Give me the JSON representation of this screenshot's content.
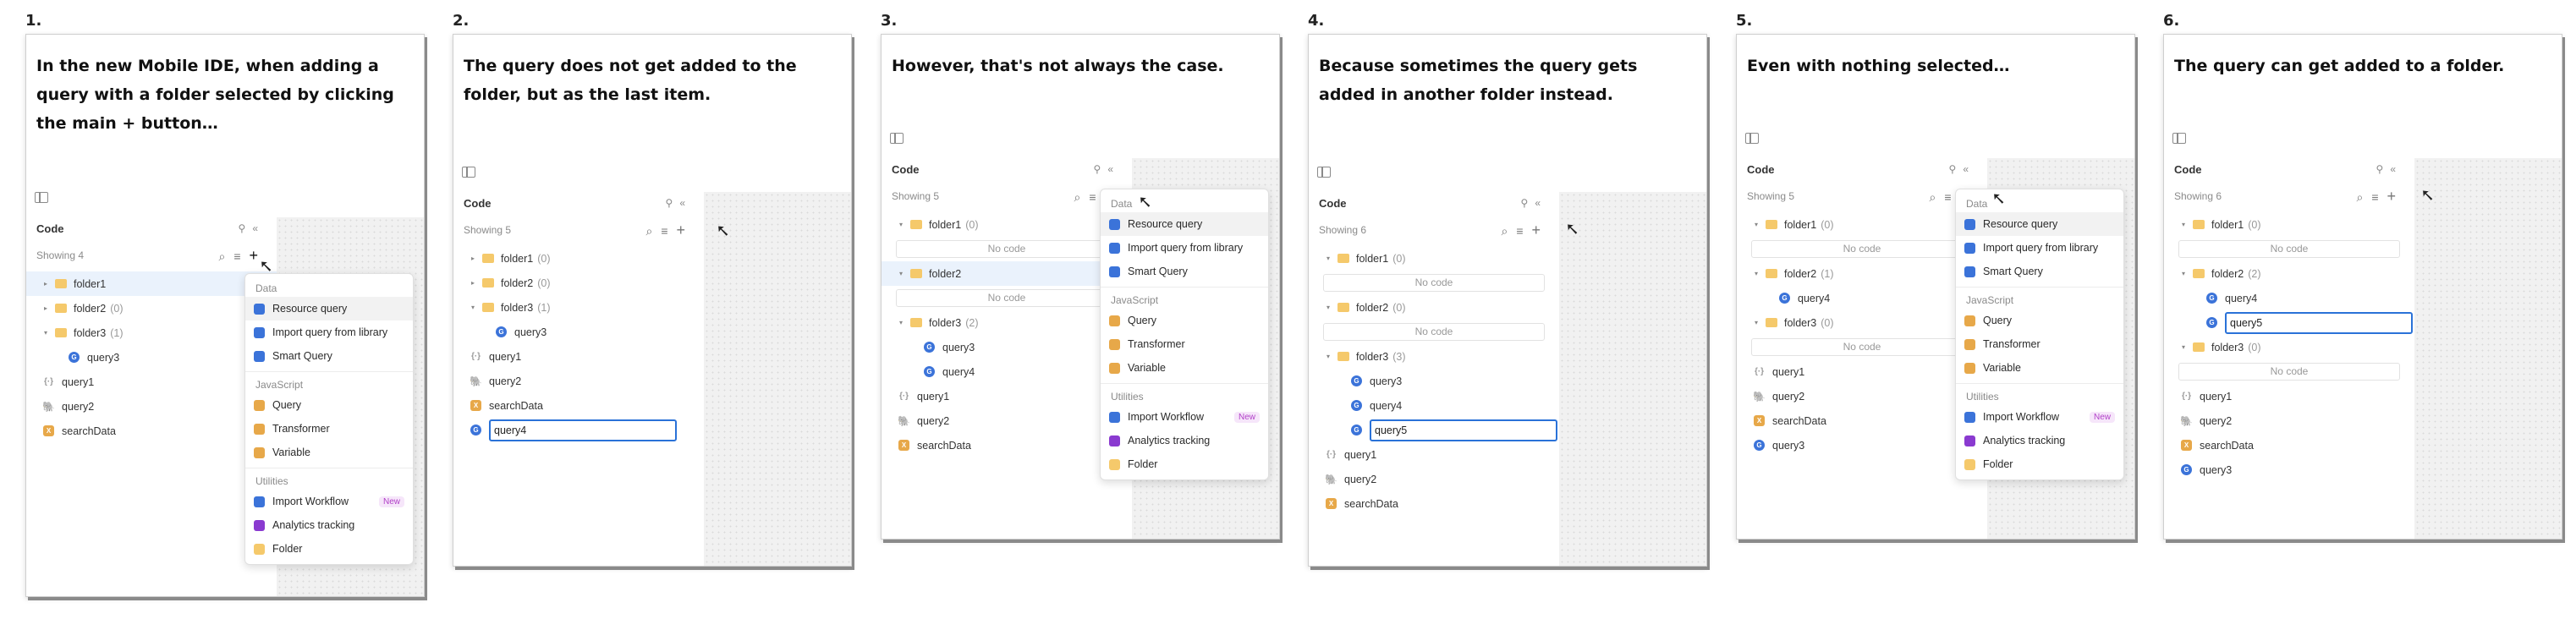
{
  "steps": [
    {
      "number": "1.",
      "caption": "In the new Mobile IDE, when adding a query with a folder selected by clicking the main + button…",
      "showing": "Showing 4",
      "tree": [
        {
          "kind": "folder",
          "label": "folder1",
          "caret": "▸",
          "selected": true
        },
        {
          "kind": "folder",
          "label": "folder2",
          "count": "(0)",
          "caret": "▸"
        },
        {
          "kind": "folder",
          "label": "folder3",
          "count": "(1)",
          "caret": "▾"
        },
        {
          "kind": "query",
          "label": "query3",
          "indent": true
        },
        {
          "kind": "transformer",
          "label": "query1"
        },
        {
          "kind": "pg",
          "label": "query2"
        },
        {
          "kind": "var",
          "label": "searchData"
        }
      ],
      "menu": true
    },
    {
      "number": "2.",
      "caption": "The query does not get added to the folder, but as the last item.",
      "showing": "Showing 5",
      "tree": [
        {
          "kind": "folder",
          "label": "folder1",
          "count": "(0)",
          "caret": "▸"
        },
        {
          "kind": "folder",
          "label": "folder2",
          "count": "(0)",
          "caret": "▸"
        },
        {
          "kind": "folder",
          "label": "folder3",
          "count": "(1)",
          "caret": "▾"
        },
        {
          "kind": "query",
          "label": "query3",
          "indent": true
        },
        {
          "kind": "transformer",
          "label": "query1"
        },
        {
          "kind": "pg",
          "label": "query2"
        },
        {
          "kind": "var",
          "label": "searchData"
        },
        {
          "kind": "query",
          "label": "query4",
          "editing": true
        }
      ]
    },
    {
      "number": "3.",
      "caption": "However, that's not always the case.",
      "showing": "Showing 5",
      "tree": [
        {
          "kind": "folder",
          "label": "folder1",
          "count": "(0)",
          "caret": "▾"
        },
        {
          "kind": "nocode"
        },
        {
          "kind": "folder",
          "label": "folder2",
          "caret": "▾",
          "selected": true
        },
        {
          "kind": "nocode"
        },
        {
          "kind": "folder",
          "label": "folder3",
          "count": "(2)",
          "caret": "▾"
        },
        {
          "kind": "query",
          "label": "query3",
          "indent": true
        },
        {
          "kind": "query",
          "label": "query4",
          "indent": true
        },
        {
          "kind": "transformer",
          "label": "query1"
        },
        {
          "kind": "pg",
          "label": "query2"
        },
        {
          "kind": "var",
          "label": "searchData"
        }
      ],
      "menu": true
    },
    {
      "number": "4.",
      "caption": "Because sometimes the query gets added in another folder instead.",
      "showing": "Showing 6",
      "tree": [
        {
          "kind": "folder",
          "label": "folder1",
          "count": "(0)",
          "caret": "▾"
        },
        {
          "kind": "nocode"
        },
        {
          "kind": "folder",
          "label": "folder2",
          "count": "(0)",
          "caret": "▾"
        },
        {
          "kind": "nocode"
        },
        {
          "kind": "folder",
          "label": "folder3",
          "count": "(3)",
          "caret": "▾"
        },
        {
          "kind": "query",
          "label": "query3",
          "indent": true
        },
        {
          "kind": "query",
          "label": "query4",
          "indent": true
        },
        {
          "kind": "query",
          "label": "query5",
          "indent": true,
          "editing": true
        },
        {
          "kind": "transformer",
          "label": "query1"
        },
        {
          "kind": "pg",
          "label": "query2"
        },
        {
          "kind": "var",
          "label": "searchData"
        }
      ]
    },
    {
      "number": "5.",
      "caption": "Even with nothing selected…",
      "showing": "Showing 5",
      "tree": [
        {
          "kind": "folder",
          "label": "folder1",
          "count": "(0)",
          "caret": "▾"
        },
        {
          "kind": "nocode"
        },
        {
          "kind": "folder",
          "label": "folder2",
          "count": "(1)",
          "caret": "▾"
        },
        {
          "kind": "query",
          "label": "query4",
          "indent": true
        },
        {
          "kind": "folder",
          "label": "folder3",
          "count": "(0)",
          "caret": "▾"
        },
        {
          "kind": "nocode"
        },
        {
          "kind": "transformer",
          "label": "query1"
        },
        {
          "kind": "pg",
          "label": "query2"
        },
        {
          "kind": "var",
          "label": "searchData"
        },
        {
          "kind": "query",
          "label": "query3"
        }
      ],
      "menu": true
    },
    {
      "number": "6.",
      "caption": "The query can get added to a folder.",
      "showing": "Showing 6",
      "tree": [
        {
          "kind": "folder",
          "label": "folder1",
          "count": "(0)",
          "caret": "▾"
        },
        {
          "kind": "nocode"
        },
        {
          "kind": "folder",
          "label": "folder2",
          "count": "(2)",
          "caret": "▾"
        },
        {
          "kind": "query",
          "label": "query4",
          "indent": true
        },
        {
          "kind": "query",
          "label": "query5",
          "indent": true,
          "editing": true
        },
        {
          "kind": "folder",
          "label": "folder3",
          "count": "(0)",
          "caret": "▾"
        },
        {
          "kind": "nocode"
        },
        {
          "kind": "transformer",
          "label": "query1"
        },
        {
          "kind": "pg",
          "label": "query2"
        },
        {
          "kind": "var",
          "label": "searchData"
        },
        {
          "kind": "query",
          "label": "query3"
        }
      ]
    }
  ],
  "panel": {
    "title": "Code",
    "no_code": "No code"
  },
  "menu": {
    "sections": [
      {
        "title": "Data",
        "items": [
          {
            "label": "Resource query",
            "color": "#3b73d9"
          },
          {
            "label": "Import query from library",
            "color": "#3b73d9"
          },
          {
            "label": "Smart Query",
            "color": "#3b73d9"
          }
        ]
      },
      {
        "title": "JavaScript",
        "items": [
          {
            "label": "Query",
            "color": "#e7a849"
          },
          {
            "label": "Transformer",
            "color": "#e7a849"
          },
          {
            "label": "Variable",
            "color": "#e7a849"
          }
        ]
      },
      {
        "title": "Utilities",
        "items": [
          {
            "label": "Import Workflow",
            "color": "#3b73d9",
            "badge": "New"
          },
          {
            "label": "Analytics tracking",
            "color": "#8a3ad0"
          },
          {
            "label": "Folder",
            "color": "#f5c96b"
          }
        ]
      }
    ]
  },
  "icons": {
    "header": [
      "pin-icon",
      "collapse-icon"
    ],
    "tools": [
      "search-icon",
      "filter-icon",
      "plus-icon"
    ],
    "cursor": "mouse-pointer-icon"
  }
}
